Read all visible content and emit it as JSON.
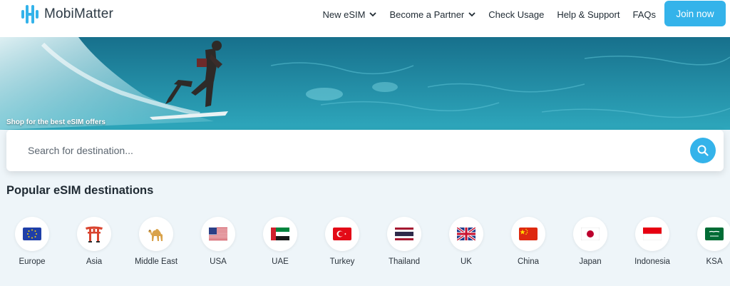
{
  "header": {
    "logo_text": "MobiMatter",
    "nav": [
      {
        "label": "New eSIM",
        "dropdown": true
      },
      {
        "label": "Become a Partner",
        "dropdown": true
      },
      {
        "label": "Check Usage",
        "dropdown": false
      },
      {
        "label": "Help & Support",
        "dropdown": false
      },
      {
        "label": "FAQs",
        "dropdown": false
      }
    ],
    "join_label": "Join now"
  },
  "hero": {
    "caption": "Shop for the best eSIM offers"
  },
  "search": {
    "placeholder": "Search for destination..."
  },
  "popular": {
    "title": "Popular eSIM destinations",
    "destinations": [
      {
        "label": "Europe",
        "icon": "eu-flag-icon"
      },
      {
        "label": "Asia",
        "icon": "torii-gate-icon"
      },
      {
        "label": "Middle East",
        "icon": "camel-icon"
      },
      {
        "label": "USA",
        "icon": "usa-flag-icon"
      },
      {
        "label": "UAE",
        "icon": "uae-flag-icon"
      },
      {
        "label": "Turkey",
        "icon": "turkey-flag-icon"
      },
      {
        "label": "Thailand",
        "icon": "thailand-flag-icon"
      },
      {
        "label": "UK",
        "icon": "uk-flag-icon"
      },
      {
        "label": "China",
        "icon": "china-flag-icon"
      },
      {
        "label": "Japan",
        "icon": "japan-flag-icon"
      },
      {
        "label": "Indonesia",
        "icon": "indonesia-flag-icon"
      },
      {
        "label": "KSA",
        "icon": "ksa-flag-icon"
      }
    ]
  },
  "colors": {
    "accent": "#34b3ea",
    "text": "#1f2a33",
    "page_bg": "#eef5f9"
  }
}
